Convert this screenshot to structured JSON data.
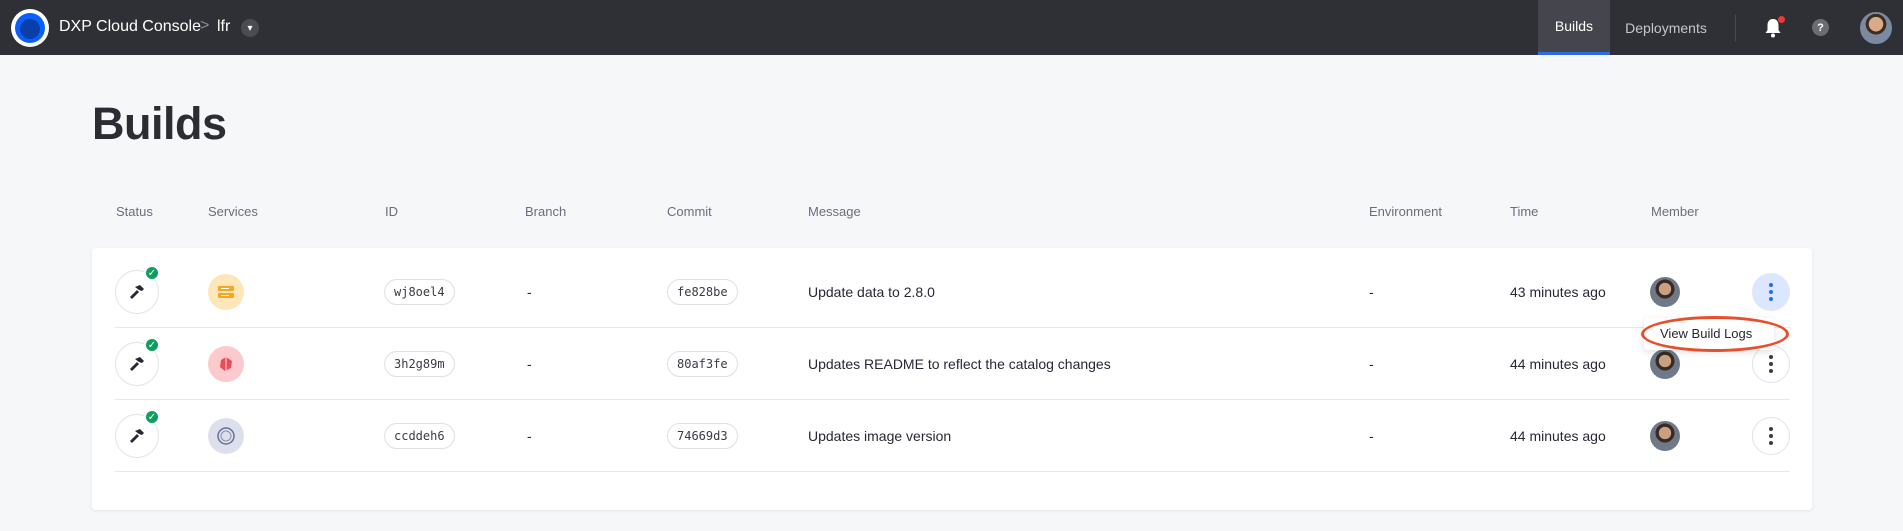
{
  "header": {
    "app_title": "DXP Cloud Console",
    "breadcrumb_separator": ">",
    "project": "lfr",
    "nav": [
      {
        "label": "Builds",
        "active": true
      },
      {
        "label": "Deployments",
        "active": false
      }
    ],
    "help_label": "?",
    "accent_color": "#2e6ce6",
    "notification_dot_color": "#e83a3a"
  },
  "page": {
    "title": "Builds"
  },
  "table": {
    "columns": [
      "Status",
      "Services",
      "ID",
      "Branch",
      "Commit",
      "Message",
      "Environment",
      "Time",
      "Member"
    ],
    "rows": [
      {
        "status": "success",
        "service_icon": "database-icon",
        "id": "wj8oel4",
        "branch": "-",
        "commit": "fe828be",
        "message": "Update data to 2.8.0",
        "environment": "-",
        "time": "43 minutes ago"
      },
      {
        "status": "success",
        "service_icon": "liferay-icon",
        "id": "3h2g89m",
        "branch": "-",
        "commit": "80af3fe",
        "message": "Updates README to reflect the catalog changes",
        "environment": "-",
        "time": "44 minutes ago"
      },
      {
        "status": "success",
        "service_icon": "search-service-icon",
        "id": "ccddeh6",
        "branch": "-",
        "commit": "74669d3",
        "message": "Updates image version",
        "environment": "-",
        "time": "44 minutes ago"
      }
    ]
  },
  "row_menu": {
    "item": "View Build Logs"
  },
  "colors": {
    "success": "#0e9e5e",
    "highlight": "#e84e2b"
  }
}
